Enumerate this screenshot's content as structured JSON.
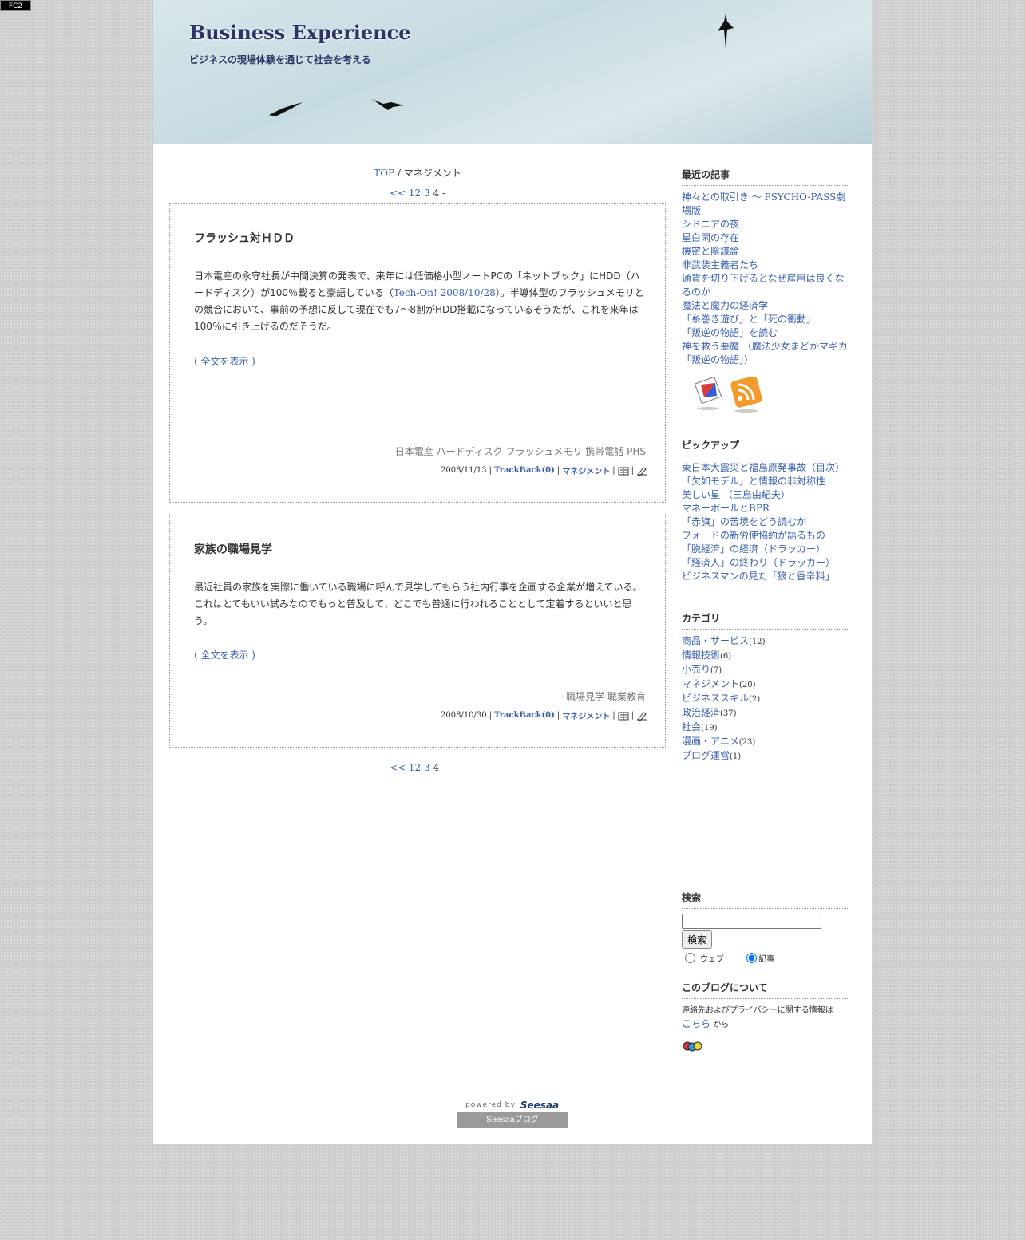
{
  "fc2_badge": "FC2",
  "header": {
    "title": "Business Experience",
    "tagline": "ビジネスの現場体験を通じて社会を考える"
  },
  "breadcrumb": {
    "top": "TOP",
    "sep": "/",
    "current": "マネジメント"
  },
  "pager": {
    "prev": "<<",
    "pages": [
      "1",
      "2",
      "3"
    ],
    "current": "4",
    "tail": "-"
  },
  "entries": [
    {
      "title": "フラッシュ対ＨＤＤ",
      "body_before": "日本電産の永守社長が中間決算の発表で、来年には低価格小型ノートPCの「ネットブック」にHDD（ハードディスク）が100％載ると豪語している（",
      "body_link": "Tech-On! 2008/10/28",
      "body_after": "）。半導体型のフラッシュメモリとの競合において、事前の予想に反して現在でも7～8割がHDD搭載になっているそうだが、これを来年は100％に引き上げるのだそうだ。",
      "more": "( 全文を表示 )",
      "tags": "日本電産 ハードディスク フラッシュメモリ 携帯電話 PHS",
      "date": "2008/11/13",
      "trackback": "TrackBack(0)",
      "category": "マネジメント"
    },
    {
      "title": "家族の職場見学",
      "body": "最近社員の家族を実際に働いている職場に呼んで見学してもらう社内行事を企画する企業が増えている。これはとてもいい試みなのでもっと普及して、どこでも普通に行われることとして定着するといいと思う。",
      "more": "( 全文を表示 )",
      "tags": "職場見学 職業教育",
      "date": "2008/10/30",
      "trackback": "TrackBack(0)",
      "category": "マネジメント"
    }
  ],
  "sidebar": {
    "recent": {
      "heading": "最近の記事",
      "items": [
        "神々との取引き ～ PSYCHO-PASS劇場版",
        "シドニアの夜",
        "星白閑の存在",
        "機密と陰謀論",
        "非武装主義者たち",
        "通貨を切り下げるとなぜ雇用は良くなるのか",
        "魔法と魔力の経済学",
        "「糸巻き遊び」と「死の衝動」",
        "「叛逆の物語」を読む",
        "神を救う悪魔 （魔法少女まどかマギカ「叛逆の物語」）"
      ]
    },
    "pickup": {
      "heading": "ピックアップ",
      "items": [
        "東日本大震災と福島原発事故（目次）",
        "「欠如モデル」と情報の非対称性",
        "美しい星 （三島由紀夫）",
        "マネーボールとBPR",
        "「赤旗」の苦境をどう読むか",
        "フォードの新労使協約が語るもの",
        "「脱経済」の経済（ドラッカー）",
        "「経済人」の終わり（ドラッカー）",
        "ビジネスマンの見た「狼と香辛料」"
      ]
    },
    "category": {
      "heading": "カテゴリ",
      "items": [
        {
          "name": "商品・サービス",
          "count": "(12)"
        },
        {
          "name": "情報技術",
          "count": "(6)"
        },
        {
          "name": "小売り",
          "count": "(7)"
        },
        {
          "name": "マネジメント",
          "count": "(20)"
        },
        {
          "name": "ビジネススキル",
          "count": "(2)"
        },
        {
          "name": "政治経済",
          "count": "(37)"
        },
        {
          "name": "社会",
          "count": "(19)"
        },
        {
          "name": "漫画・アニメ",
          "count": "(23)"
        },
        {
          "name": "ブログ運営",
          "count": "(1)"
        }
      ]
    },
    "search": {
      "heading": "検索",
      "button": "検索",
      "input_value": "",
      "option_web": "ウェブ",
      "option_article": "記事",
      "selected": "記事"
    },
    "about": {
      "heading": "このブログについて",
      "text": "連絡先およびプライバシーに関する情報は",
      "link": "こちら",
      "suffix": "から"
    }
  },
  "footer": {
    "powered_by": "powered by",
    "brand": "Seesaa",
    "button": "Seesaaブログ"
  },
  "colors": {
    "link": "#3a62b0",
    "title": "#2c3466",
    "page_bg": "#cfcfcf"
  }
}
